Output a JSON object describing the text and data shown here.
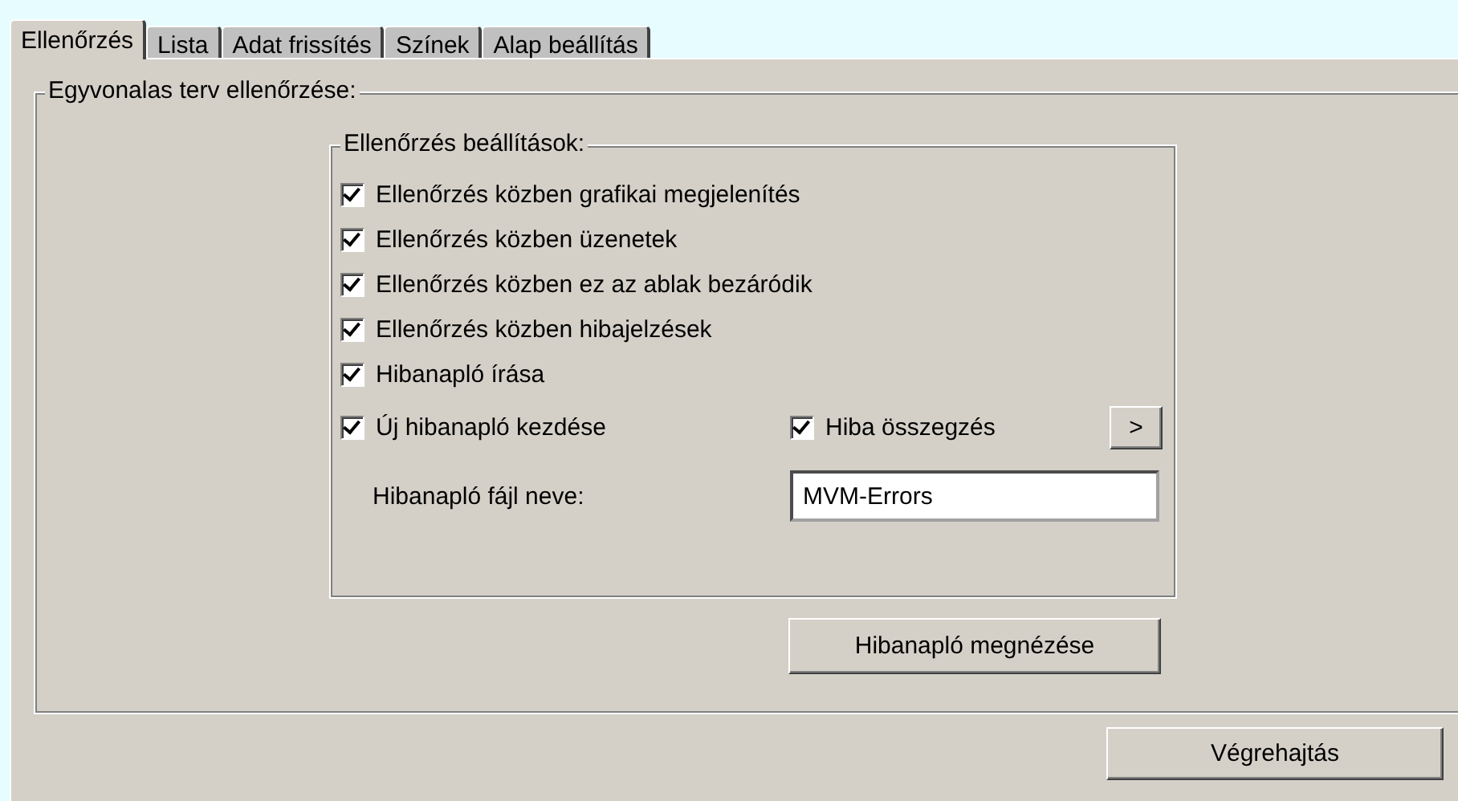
{
  "tabs": [
    {
      "label": "Ellenőrzés",
      "selected": true
    },
    {
      "label": "Lista",
      "selected": false
    },
    {
      "label": "Adat frissítés",
      "selected": false
    },
    {
      "label": "Színek",
      "selected": false
    },
    {
      "label": "Alap beállítás",
      "selected": false
    }
  ],
  "group": {
    "title": "Egyvonalas terv ellenőrzése:",
    "settings": {
      "title": "Ellenőrzés beállítások:",
      "options": [
        {
          "label": "Ellenőrzés közben grafikai megjelenítés",
          "checked": true
        },
        {
          "label": "Ellenőrzés közben üzenetek",
          "checked": true
        },
        {
          "label": "Ellenőrzés közben ez az ablak bezáródik",
          "checked": true
        },
        {
          "label": "Ellenőrzés közben hibajelzések",
          "checked": true
        },
        {
          "label": "Hibanapló írása",
          "checked": true
        },
        {
          "label": "Új hibanapló kezdése",
          "checked": true
        }
      ],
      "summary": {
        "label": "Hiba összegzés",
        "checked": true
      },
      "more_button": ">",
      "file_label": "Hibanapló fájl neve:",
      "file_value": "MVM-Errors"
    },
    "view_button": "Hibanapló megnézése"
  },
  "run_button": "Végrehajtás"
}
